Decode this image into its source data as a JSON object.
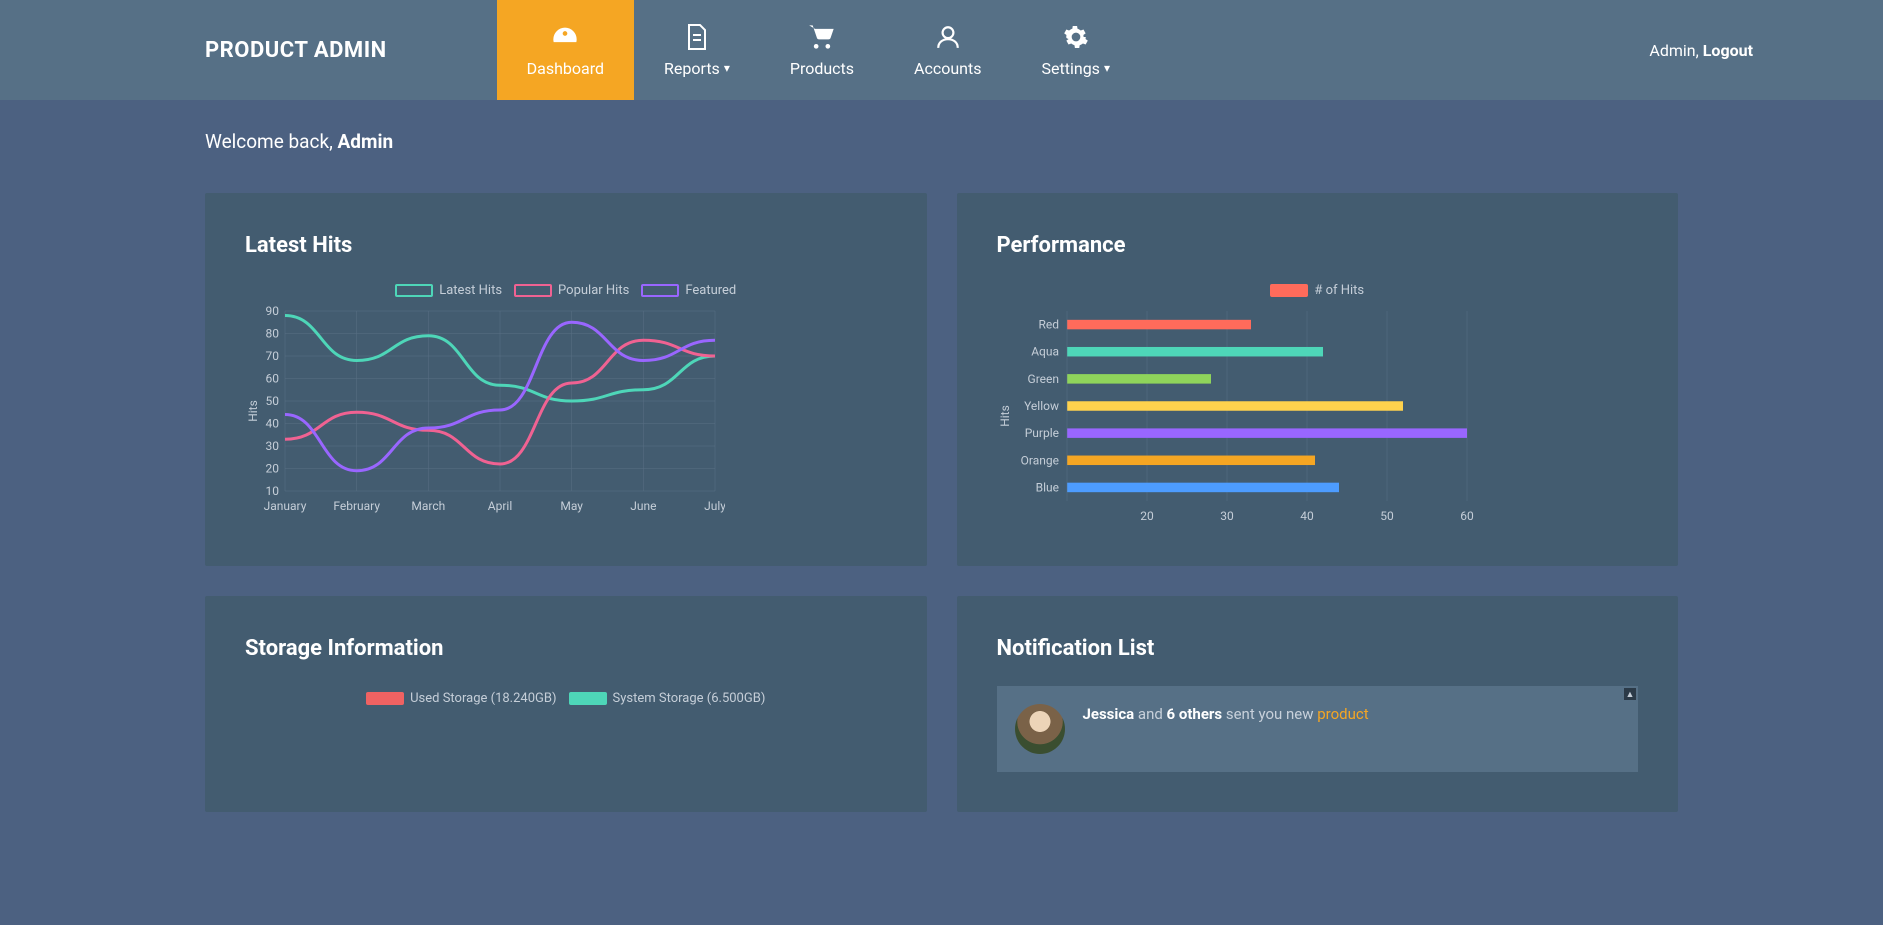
{
  "brand": "PRODUCT ADMIN",
  "nav": [
    {
      "label": "Dashboard",
      "icon": "gauge",
      "active": true,
      "chevron": false
    },
    {
      "label": "Reports",
      "icon": "file",
      "active": false,
      "chevron": true
    },
    {
      "label": "Products",
      "icon": "cart",
      "active": false,
      "chevron": false
    },
    {
      "label": "Accounts",
      "icon": "user",
      "active": false,
      "chevron": false
    },
    {
      "label": "Settings",
      "icon": "gear",
      "active": false,
      "chevron": true
    }
  ],
  "user": {
    "name": "Admin",
    "logout": "Logout"
  },
  "welcome": {
    "prefix": "Welcome back, ",
    "name": "Admin"
  },
  "panels": {
    "latest_hits": "Latest Hits",
    "performance": "Performance",
    "storage": "Storage Information",
    "notifications": "Notification List"
  },
  "storage_legend": [
    {
      "color": "#f06262",
      "label": "Used Storage (18.240GB)"
    },
    {
      "color": "#4ed6b8",
      "label": "System Storage (6.500GB)"
    }
  ],
  "notification": {
    "person": "Jessica",
    "mid1": " and ",
    "others": "6 others",
    "mid2": " sent you new ",
    "link": "product"
  },
  "chart_data": [
    {
      "type": "line",
      "title": "Latest Hits",
      "xlabel": "",
      "ylabel": "Hits",
      "categories": [
        "January",
        "February",
        "March",
        "April",
        "May",
        "June",
        "July"
      ],
      "ylim": [
        10,
        90
      ],
      "series": [
        {
          "name": "Latest Hits",
          "color": "#4ed6b8",
          "values": [
            88,
            68,
            79,
            57,
            50,
            55,
            70
          ]
        },
        {
          "name": "Popular Hits",
          "color": "#f06292",
          "values": [
            33,
            45,
            37,
            22,
            58,
            77,
            70
          ]
        },
        {
          "name": "Featured",
          "color": "#9966ff",
          "values": [
            44,
            19,
            38,
            46,
            85,
            68,
            77
          ]
        }
      ]
    },
    {
      "type": "bar",
      "orientation": "horizontal",
      "title": "Performance",
      "xlabel": "",
      "ylabel": "Hits",
      "legend": "# of Hits",
      "categories": [
        "Red",
        "Aqua",
        "Green",
        "Yellow",
        "Purple",
        "Orange",
        "Blue"
      ],
      "colors": [
        "#ff6b5b",
        "#4ed6b8",
        "#8fd45b",
        "#ffd24d",
        "#9966ff",
        "#f5a623",
        "#4d9cff"
      ],
      "xlim": [
        10,
        60
      ],
      "values": [
        33,
        42,
        28,
        52,
        60,
        41,
        44
      ]
    }
  ]
}
